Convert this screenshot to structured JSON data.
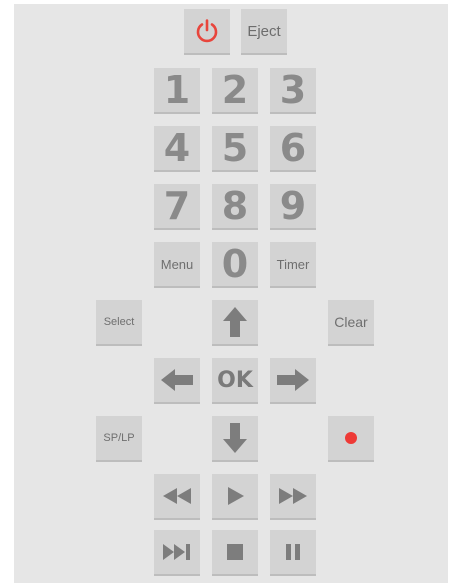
{
  "colors": {
    "panel": "#e6e6e6",
    "button": "#d3d3d3",
    "glyph": "#7a7a7a",
    "power": "#e8453c",
    "record": "#ee3a36"
  },
  "top": {
    "power_icon": "power-icon",
    "eject_label": "Eject"
  },
  "digits": [
    "1",
    "2",
    "3",
    "4",
    "5",
    "6",
    "7",
    "8",
    "9",
    "0"
  ],
  "controls": {
    "menu_label": "Menu",
    "timer_label": "Timer",
    "select_label": "Select",
    "clear_label": "Clear",
    "ok_label": "OK",
    "splp_label": "SP/LP"
  },
  "icons": {
    "up": "arrow-up-icon",
    "down": "arrow-down-icon",
    "left": "arrow-left-icon",
    "right": "arrow-right-icon",
    "record": "record-icon",
    "rewind": "rewind-icon",
    "play": "play-icon",
    "fast_forward": "fast-forward-icon",
    "skip": "skip-next-icon",
    "stop": "stop-icon",
    "pause": "pause-icon"
  }
}
